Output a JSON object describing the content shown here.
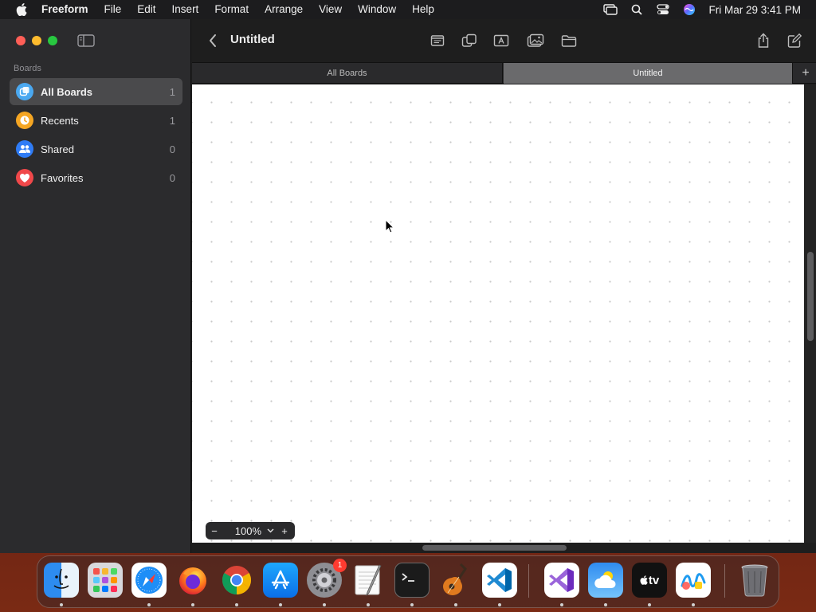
{
  "menubar": {
    "app_name": "Freeform",
    "menus": [
      "File",
      "Edit",
      "Insert",
      "Format",
      "Arrange",
      "View",
      "Window",
      "Help"
    ],
    "clock": "Fri Mar 29  3:41 PM",
    "status_icons": [
      "screen-mirroring-icon",
      "search-icon",
      "control-center-icon",
      "siri-icon"
    ]
  },
  "sidebar": {
    "section_label": "Boards",
    "items": [
      {
        "label": "All Boards",
        "count": "1",
        "icon": "all-boards-icon",
        "color": "#4aa8f0",
        "selected": true
      },
      {
        "label": "Recents",
        "count": "1",
        "icon": "clock-icon",
        "color": "#f5a623",
        "selected": false
      },
      {
        "label": "Shared",
        "count": "0",
        "icon": "people-icon",
        "color": "#2f7cf6",
        "selected": false
      },
      {
        "label": "Favorites",
        "count": "0",
        "icon": "heart-icon",
        "color": "#f0484a",
        "selected": false
      }
    ]
  },
  "toolbar": {
    "title": "Untitled",
    "tools": [
      "sticky-note-icon",
      "shapes-icon",
      "text-box-icon",
      "media-icon",
      "folder-icon"
    ],
    "actions": [
      "share-icon",
      "new-board-icon"
    ]
  },
  "tabs": {
    "items": [
      {
        "label": "All Boards",
        "active": false
      },
      {
        "label": "Untitled",
        "active": true
      }
    ],
    "add_label": "+"
  },
  "zoom": {
    "minus_label": "−",
    "value": "100%",
    "plus_label": "+"
  },
  "dock": {
    "apps": [
      {
        "name": "Finder",
        "icon": "finder-icon",
        "running": true
      },
      {
        "name": "Launchpad",
        "icon": "launchpad-icon",
        "running": false
      },
      {
        "name": "Safari",
        "icon": "safari-icon",
        "running": true
      },
      {
        "name": "Firefox",
        "icon": "firefox-icon",
        "running": true
      },
      {
        "name": "Chrome",
        "icon": "chrome-icon",
        "running": true
      },
      {
        "name": "App Store",
        "icon": "app-store-icon",
        "running": true
      },
      {
        "name": "System Settings",
        "icon": "system-settings-icon",
        "running": true,
        "badge": "1"
      },
      {
        "name": "TextEdit",
        "icon": "textedit-icon",
        "running": true
      },
      {
        "name": "Terminal",
        "icon": "terminal-icon",
        "running": true
      },
      {
        "name": "GarageBand",
        "icon": "garageband-icon",
        "running": true
      },
      {
        "name": "Visual Studio Code",
        "icon": "vscode-icon",
        "running": true
      },
      {
        "name": "Visual Studio",
        "icon": "visual-studio-icon",
        "running": true
      },
      {
        "name": "Weather",
        "icon": "weather-icon",
        "running": true
      },
      {
        "name": "Apple TV",
        "icon": "apple-tv-icon",
        "running": true
      },
      {
        "name": "Freeform",
        "icon": "freeform-icon",
        "running": true
      },
      {
        "name": "Trash",
        "icon": "trash-icon",
        "running": false
      }
    ],
    "tv_label": "tv"
  }
}
